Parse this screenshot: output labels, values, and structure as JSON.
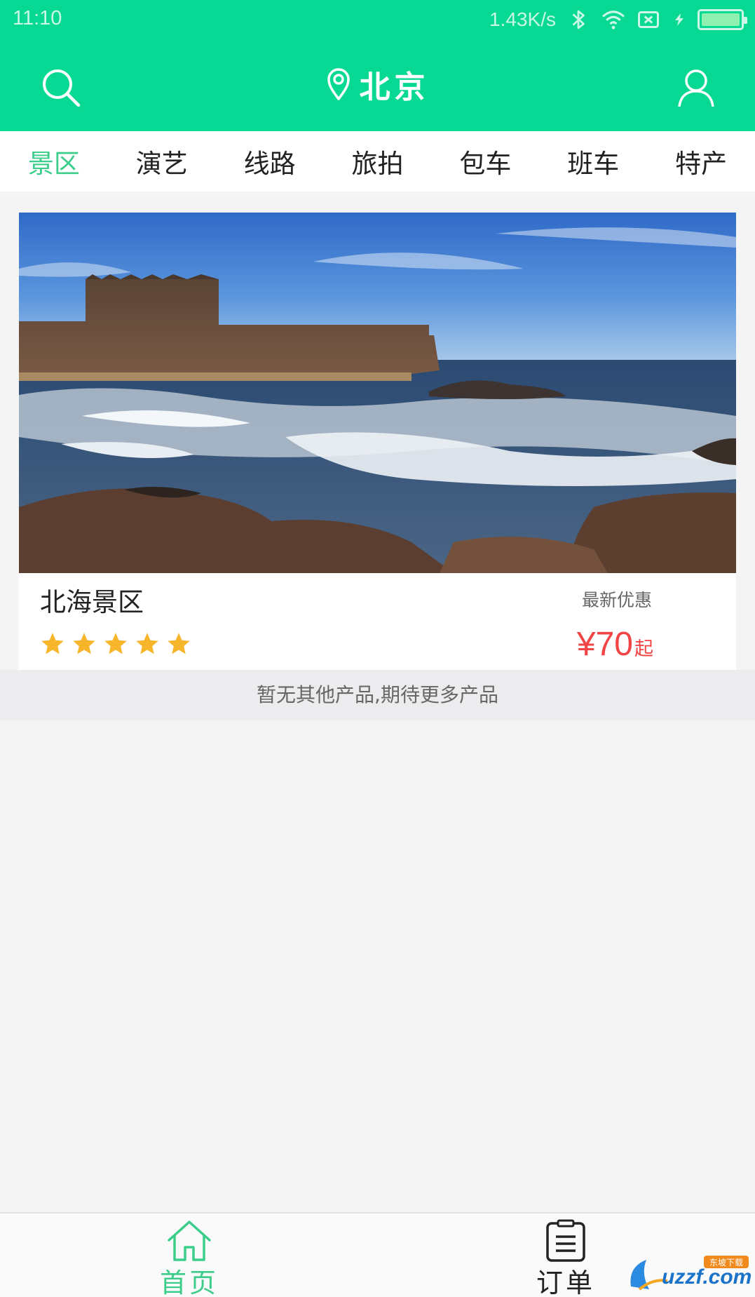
{
  "status_bar": {
    "time": "11:10",
    "net_speed": "1.43K/s",
    "icons": [
      "bluetooth-icon",
      "wifi-icon",
      "sim-icon",
      "charging-icon",
      "battery-icon"
    ]
  },
  "header": {
    "city": "北京",
    "icons": [
      "search-icon",
      "location-pin-icon",
      "user-icon"
    ],
    "accent_color": "#07d893"
  },
  "tabs": [
    {
      "label": "景区",
      "active": true
    },
    {
      "label": "演艺",
      "active": false
    },
    {
      "label": "线路",
      "active": false
    },
    {
      "label": "旅拍",
      "active": false
    },
    {
      "label": "包车",
      "active": false
    },
    {
      "label": "班车",
      "active": false
    },
    {
      "label": "特产",
      "active": false
    }
  ],
  "products": [
    {
      "title": "北海景区",
      "rating": 5,
      "rating_max": 5,
      "promo": "最新优惠",
      "price": "¥70",
      "price_suffix": "起"
    }
  ],
  "list_footer": "暂无其他产品,期待更多产品",
  "bottom_nav": [
    {
      "label": "首页",
      "icon": "home-icon",
      "active": true
    },
    {
      "label": "订单",
      "icon": "clipboard-icon",
      "active": false
    }
  ],
  "watermark": {
    "text": "uzzf.com",
    "sub": "东坡下载"
  }
}
